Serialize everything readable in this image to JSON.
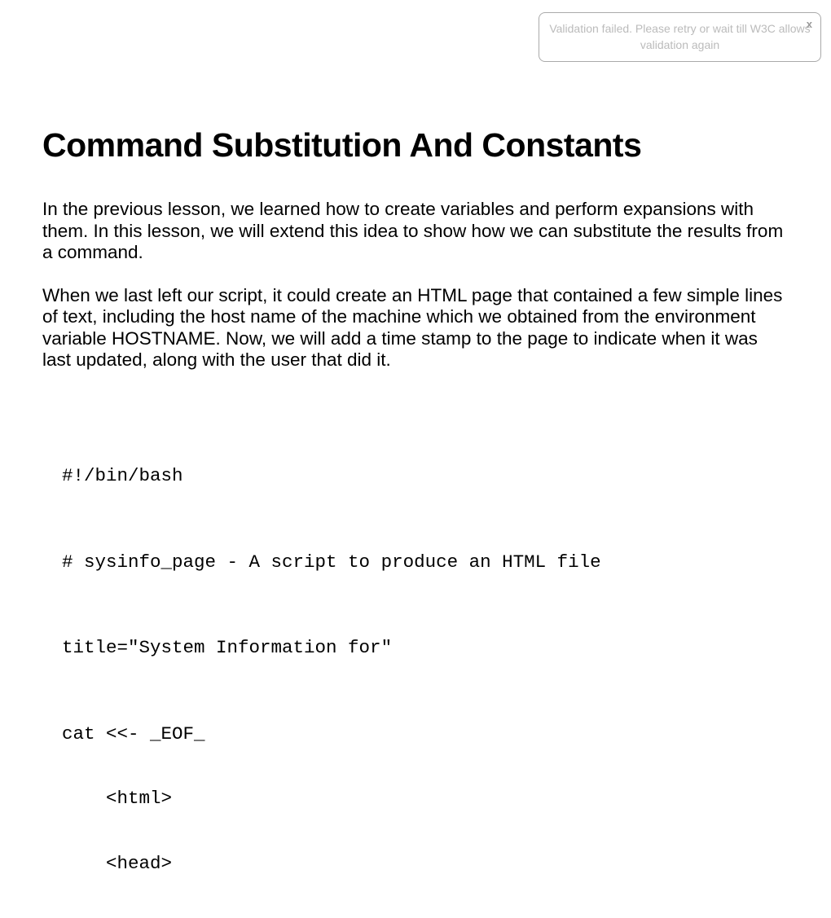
{
  "notification": {
    "text": "Validation failed. Please retry or wait till W3C allows validation again",
    "close": "x"
  },
  "title": "Command Substitution And Constants",
  "paragraph1": "In the previous lesson, we learned how to create variables and perform expansions with them. In this lesson, we will extend this idea to show how we can substitute the results from a command.",
  "paragraph2": "When we last left our script, it could create an HTML page that contained a few simple lines of text, including the host name of the machine which we obtained from the environment variable HOSTNAME. Now, we will add a time stamp to the page to indicate when it was last updated, along with the user that did it.",
  "code": {
    "line1": "#!/bin/bash",
    "line2": "# sysinfo_page - A script to produce an HTML file",
    "line3": "title=\"System Information for\"",
    "line4": "cat <<- _EOF_",
    "line5": "    <html>",
    "line6": "    <head>"
  }
}
